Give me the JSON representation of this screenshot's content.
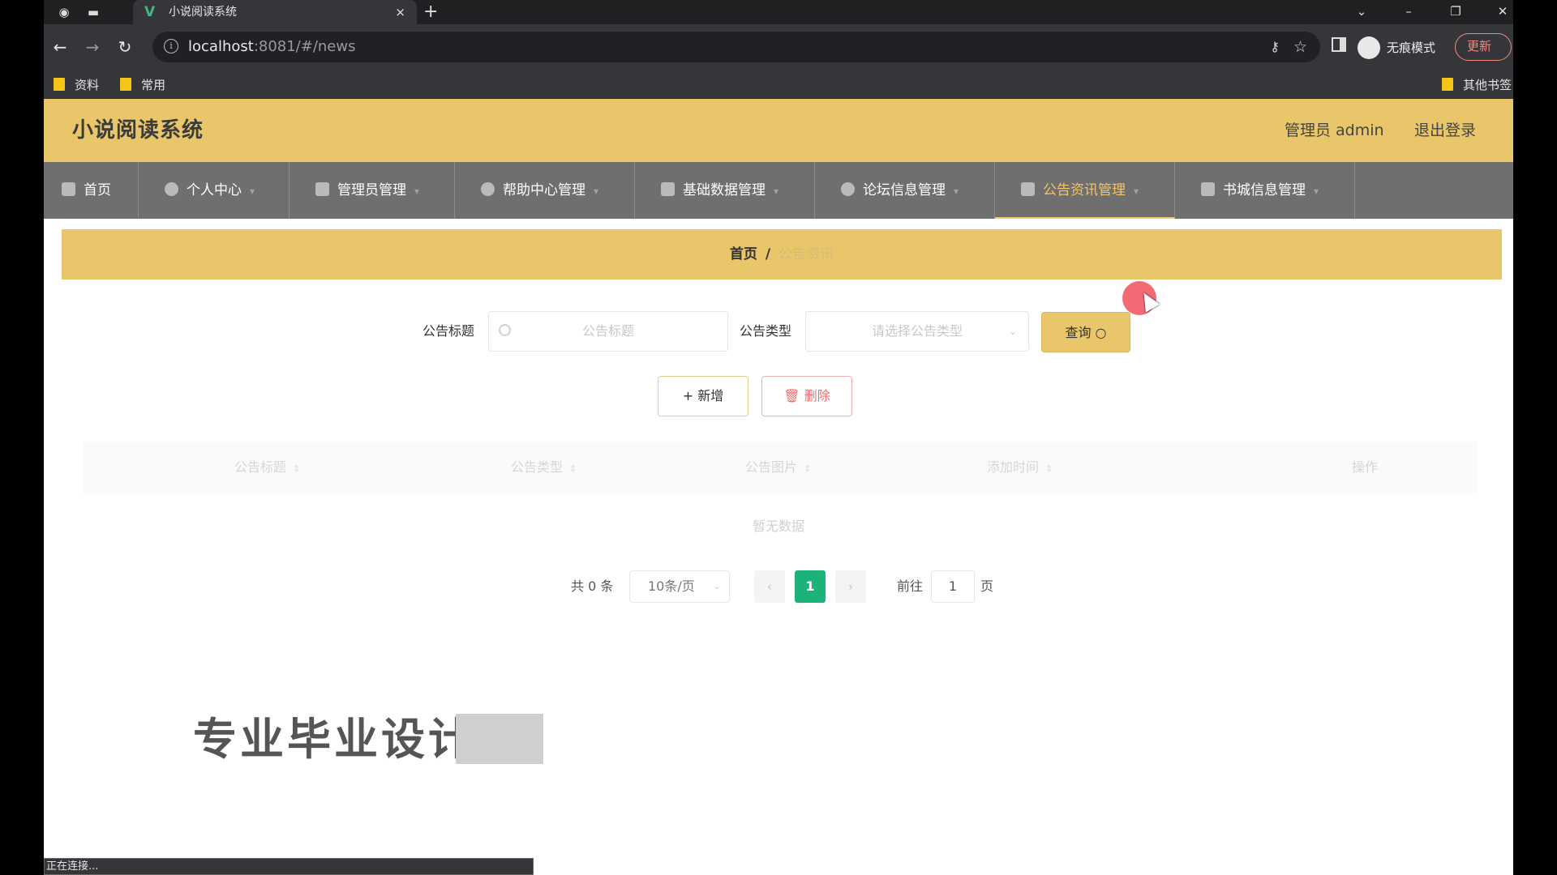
{
  "browser": {
    "tab_title": "小说阅读系统",
    "tab_close": "×",
    "new_tab": "+",
    "url_host": "localhost",
    "url_rest": ":8081/#/news",
    "incognito_label": "无痕模式",
    "update_label": "更新",
    "bookmarks": [
      "资料",
      "常用"
    ],
    "other_bookmarks": "其他书签",
    "status_text": "正在连接..."
  },
  "site": {
    "title": "小说阅读系统",
    "user_label": "管理员 admin",
    "logout": "退出登录"
  },
  "menu": [
    {
      "label": "首页"
    },
    {
      "label": "个人中心"
    },
    {
      "label": "管理员管理"
    },
    {
      "label": "帮助中心管理"
    },
    {
      "label": "基础数据管理"
    },
    {
      "label": "论坛信息管理"
    },
    {
      "label": "公告资讯管理"
    },
    {
      "label": "书城信息管理"
    }
  ],
  "breadcrumb": {
    "home": "首页",
    "sep": "/",
    "current": "公告资讯"
  },
  "search": {
    "title_label": "公告标题",
    "title_placeholder": "公告标题",
    "type_label": "公告类型",
    "type_placeholder": "请选择公告类型",
    "query_label": "查询 ○"
  },
  "actions": {
    "add": "+ 新增",
    "delete": "删除"
  },
  "table": {
    "columns": [
      "公告标题",
      "公告类型",
      "公告图片",
      "添加时间",
      "操作"
    ],
    "empty_text": "暂无数据"
  },
  "pagination": {
    "total": "共 0 条",
    "page_size": "10条/页",
    "prev": "‹",
    "current": "1",
    "next": "›",
    "goto_label": "前往",
    "goto_value": "1",
    "page_unit": "页"
  },
  "watermark": "专业毕业设计",
  "colors": {
    "header": "#e9c66a",
    "menu": "#6f6f6f",
    "menu_active": "#f1c56b",
    "page_active": "#1bb37a",
    "delete": "#f56c6c"
  }
}
